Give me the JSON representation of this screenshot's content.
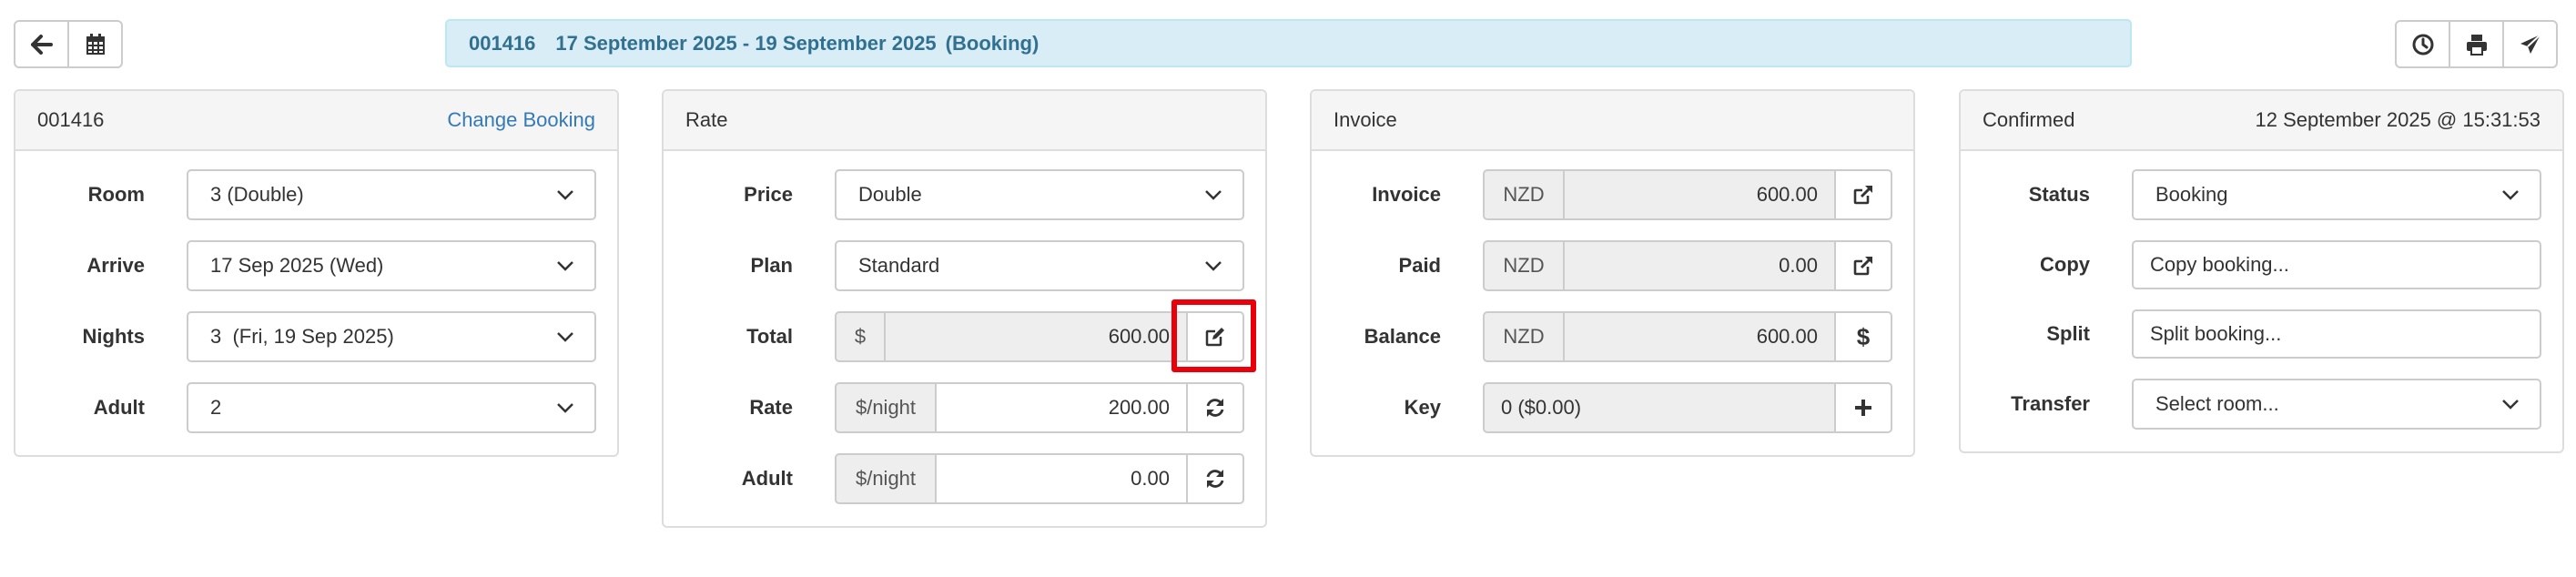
{
  "toolbar_left": [
    {
      "icon": "arrow-left-icon"
    },
    {
      "icon": "calendar-icon"
    }
  ],
  "toolbar_right": [
    {
      "icon": "clock-icon"
    },
    {
      "icon": "print-icon"
    },
    {
      "icon": "send-icon"
    }
  ],
  "banner": {
    "booking_number": "001416",
    "dates": "17 September 2025 - 19 September 2025",
    "status": "(Booking)"
  },
  "booking_panel": {
    "title": "001416",
    "action_link": "Change Booking",
    "room": {
      "label": "Room",
      "value": "3 (Double)"
    },
    "arrive": {
      "label": "Arrive",
      "value": "17 Sep 2025 (Wed)"
    },
    "nights": {
      "label": "Nights",
      "value": "3  (Fri, 19 Sep 2025)"
    },
    "adult": {
      "label": "Adult",
      "value": "2"
    }
  },
  "rate_panel": {
    "title": "Rate",
    "price": {
      "label": "Price",
      "value": "Double"
    },
    "plan": {
      "label": "Plan",
      "value": "Standard"
    },
    "total": {
      "label": "Total",
      "prefix": "$",
      "value": "600.00",
      "button_icon": "edit-icon"
    },
    "rate": {
      "label": "Rate",
      "prefix": "$/night",
      "value": "200.00",
      "button_icon": "refresh-icon"
    },
    "adult": {
      "label": "Adult",
      "prefix": "$/night",
      "value": "0.00",
      "button_icon": "refresh-icon"
    }
  },
  "invoice_panel": {
    "title": "Invoice",
    "invoice": {
      "label": "Invoice",
      "currency": "NZD",
      "value": "600.00",
      "button_icon": "external-link-icon"
    },
    "paid": {
      "label": "Paid",
      "currency": "NZD",
      "value": "0.00",
      "button_icon": "external-link-icon"
    },
    "balance": {
      "label": "Balance",
      "currency": "NZD",
      "value": "600.00",
      "button_icon": "dollar-icon"
    },
    "key": {
      "label": "Key",
      "value": "0 ($0.00)",
      "button_icon": "plus-icon"
    }
  },
  "status_panel": {
    "title": "Confirmed",
    "timestamp": "12 September 2025 @ 15:31:53",
    "status": {
      "label": "Status",
      "value": "Booking"
    },
    "copy": {
      "label": "Copy",
      "value": "Copy booking..."
    },
    "split": {
      "label": "Split",
      "value": "Split booking..."
    },
    "transfer": {
      "label": "Transfer",
      "value": "Select room..."
    }
  },
  "colors": {
    "banner_bg": "#d9edf7",
    "banner_text": "#31708f",
    "link": "#337ab7",
    "highlight": "#e8000b"
  }
}
